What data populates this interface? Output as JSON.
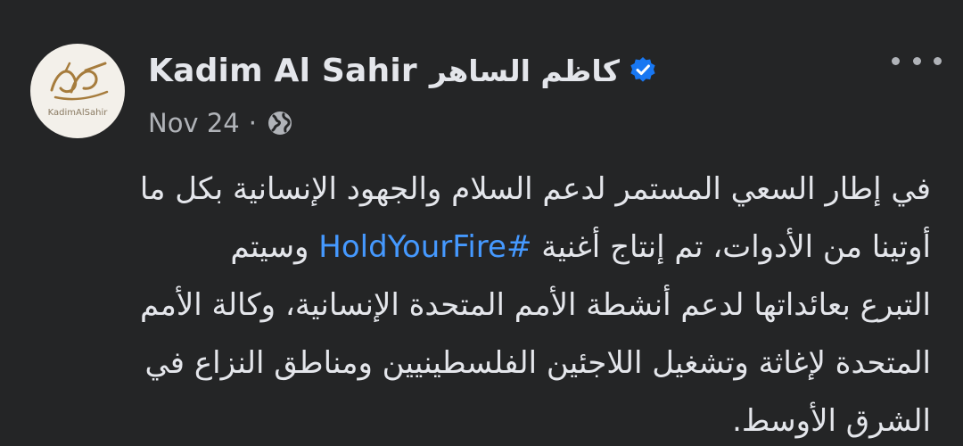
{
  "post": {
    "author": {
      "name_latin": "Kadim Al Sahir",
      "name_arabic": "كاظم الساهر",
      "avatar_caption": "KadimAlSahir",
      "verified": true
    },
    "date": "Nov 24",
    "separator": "·",
    "privacy_icon": "globe-icon",
    "more_icon": "more-options-icon",
    "text": {
      "line1": "في إطار السعي المستمر لدعم السلام والجهود الإنسانية بكل ما",
      "line2_before": "أوتينا من الأدوات، تم إنتاج أغنية",
      "hashtag": "#HoldYourFire",
      "line2_after": "وسيتم",
      "line3": "التبرع بعائداتها لدعم أنشطة الأمم المتحدة الإنسانية، وكالة الأمم",
      "line4": "المتحدة لإغاثة وتشغيل اللاجئين الفلسطينيين ومناطق النزاع في",
      "line5": "الشرق الأوسط."
    },
    "colors": {
      "background": "#242526",
      "primary_text": "#e4e6eb",
      "secondary_text": "#b0b3b8",
      "link": "#4599ff",
      "verified_badge": "#1877f2"
    }
  }
}
